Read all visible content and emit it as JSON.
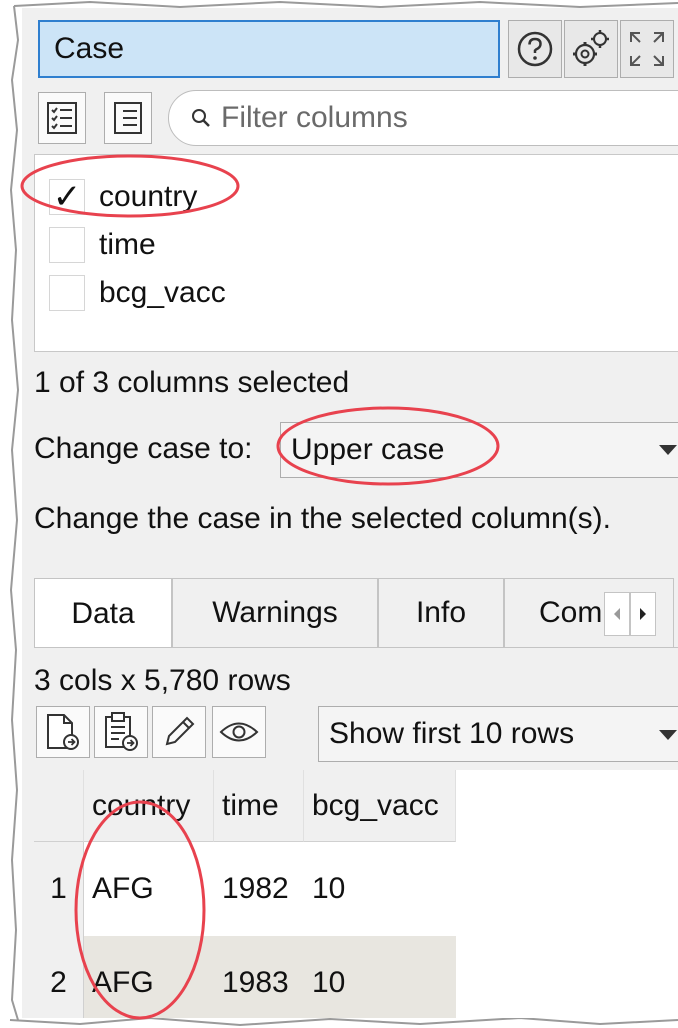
{
  "header": {
    "title": "Case",
    "help_icon": "help-icon",
    "settings_icon": "gears-icon",
    "expand_icon": "expand-icon"
  },
  "filter": {
    "placeholder": "Filter columns",
    "value": ""
  },
  "columns": [
    {
      "name": "country",
      "checked": true
    },
    {
      "name": "time",
      "checked": false
    },
    {
      "name": "bcg_vacc",
      "checked": false
    }
  ],
  "selection_status": "1 of 3 columns selected",
  "change_case": {
    "label": "Change case to:",
    "value": "Upper case"
  },
  "description": "Change the case in the selected column(s).",
  "tabs": [
    {
      "label": "Data",
      "active": true
    },
    {
      "label": "Warnings",
      "active": false
    },
    {
      "label": "Info",
      "active": false
    },
    {
      "label": "Com",
      "active": false
    }
  ],
  "data_summary": "3 cols x 5,780 rows",
  "rows_select": {
    "value": "Show first 10 rows"
  },
  "table": {
    "headers": [
      "country",
      "time",
      "bcg_vacc"
    ],
    "rows": [
      {
        "index": "1",
        "cells": [
          "AFG",
          "1982",
          "10"
        ]
      },
      {
        "index": "2",
        "cells": [
          "AFG",
          "1983",
          "10"
        ]
      }
    ]
  },
  "colors": {
    "title_bg": "#cce4f7",
    "title_border": "#2f7fcf",
    "annotation": "#e8424e",
    "alt_row": "#e8e6e0"
  }
}
